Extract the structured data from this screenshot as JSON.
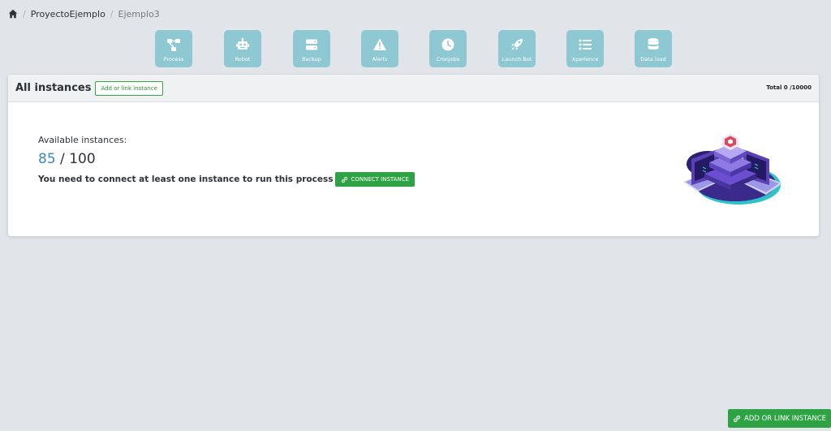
{
  "breadcrumb": {
    "items": [
      {
        "label": "ProyectoEjemplo"
      },
      {
        "label": "Ejemplo3"
      }
    ]
  },
  "toolbar": {
    "tiles": [
      {
        "label": "Process",
        "icon": "process-icon"
      },
      {
        "label": "Robot",
        "icon": "robot-icon"
      },
      {
        "label": "Backup",
        "icon": "server-icon"
      },
      {
        "label": "Alerts",
        "icon": "warning-icon"
      },
      {
        "label": "Cronjobs",
        "icon": "clock-icon"
      },
      {
        "label": "Launch Bot",
        "icon": "rocket-icon"
      },
      {
        "label": "Xperience",
        "icon": "list-icon"
      },
      {
        "label": "Data load",
        "icon": "database-icon"
      }
    ]
  },
  "card": {
    "title": "All instances",
    "add_link_label": "Add or link instance",
    "total_label": "Total 0 /10000",
    "available_label": "Available instances:",
    "available_count": "85",
    "count_separator": "/",
    "available_total": "100",
    "message": "You need to connect at least one instance to run this process",
    "connect_label": "CONNECT INSTANCE"
  },
  "floating": {
    "add_link_label": "ADD OR LINK INSTANCE"
  },
  "colors": {
    "tile": "#8ec8d3",
    "green": "#2ea344",
    "blue_count": "#3a86c4",
    "background": "#e1e5ea"
  }
}
